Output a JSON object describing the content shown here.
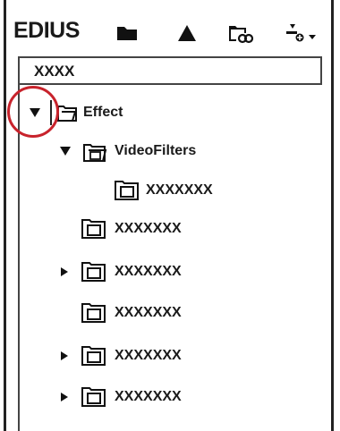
{
  "toolbar": {
    "brand": "EDIUS",
    "icons": [
      "folder-icon",
      "up-arrow-icon",
      "folder-link-icon",
      "add-dropdown-icon"
    ]
  },
  "path": {
    "value": "XXXX"
  },
  "tree": {
    "root": {
      "label": "Effect",
      "expanded": true
    },
    "child": {
      "label": "VideoFilters",
      "expanded": true
    },
    "grandchild": {
      "label": "XXXXXXX"
    },
    "items": [
      {
        "label": "XXXXXXX",
        "toggle": "none"
      },
      {
        "label": "XXXXXXX",
        "toggle": "collapsed"
      },
      {
        "label": "XXXXXXX",
        "toggle": "none"
      },
      {
        "label": "XXXXXXX",
        "toggle": "collapsed"
      },
      {
        "label": "XXXXXXX",
        "toggle": "collapsed"
      }
    ]
  },
  "colors": {
    "highlight": "#c8232c"
  }
}
